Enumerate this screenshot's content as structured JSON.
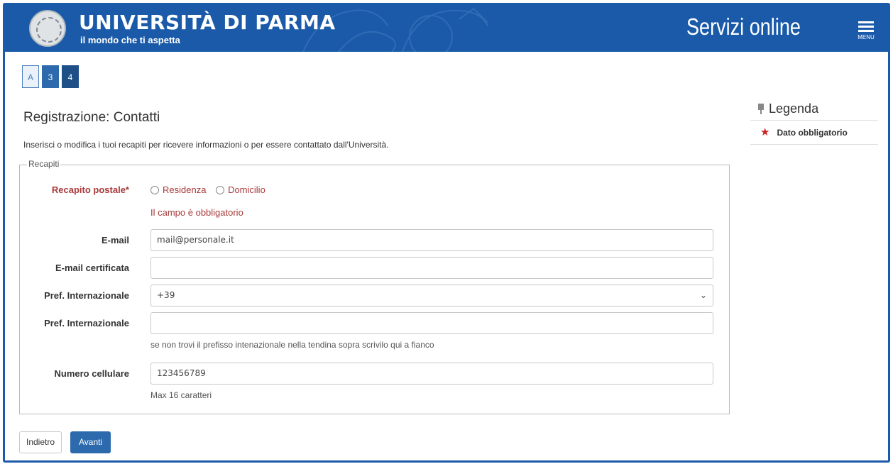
{
  "header": {
    "brand_title": "UNIVERSITÀ DI PARMA",
    "brand_subtitle": "il mondo che ti aspetta",
    "service_title": "Servizi online",
    "menu_label": "MENU",
    "colors": {
      "primary": "#1a5aa8"
    }
  },
  "steps": [
    {
      "label": "A",
      "state": "active"
    },
    {
      "label": "3",
      "state": "done"
    },
    {
      "label": "4",
      "state": "current"
    }
  ],
  "page": {
    "title": "Registrazione: Contatti",
    "intro": "Inserisci o modifica i tuoi recapiti per ricevere informazioni o per essere contattato dall'Università."
  },
  "form": {
    "legend": "Recapiti",
    "recapito_postale": {
      "label": "Recapito postale*",
      "options": [
        "Residenza",
        "Domicilio"
      ],
      "error": "Il campo è obbligatorio"
    },
    "email": {
      "label": "E-mail",
      "value": "mail@personale.it"
    },
    "pec": {
      "label": "E-mail certificata",
      "value": ""
    },
    "prefisso_select": {
      "label": "Pref. Internazionale",
      "value": "+39"
    },
    "prefisso_text": {
      "label": "Pref. Internazionale",
      "value": "",
      "help": "se non trovi il prefisso intenazionale nella tendina sopra scrivilo qui a fianco"
    },
    "cellulare": {
      "label": "Numero cellulare",
      "value": "123456789",
      "help": "Max 16 caratteri"
    }
  },
  "buttons": {
    "back": "Indietro",
    "next": "Avanti"
  },
  "legenda": {
    "title": "Legenda",
    "items": [
      {
        "icon": "star-icon",
        "label": "Dato obbligatorio"
      }
    ]
  }
}
